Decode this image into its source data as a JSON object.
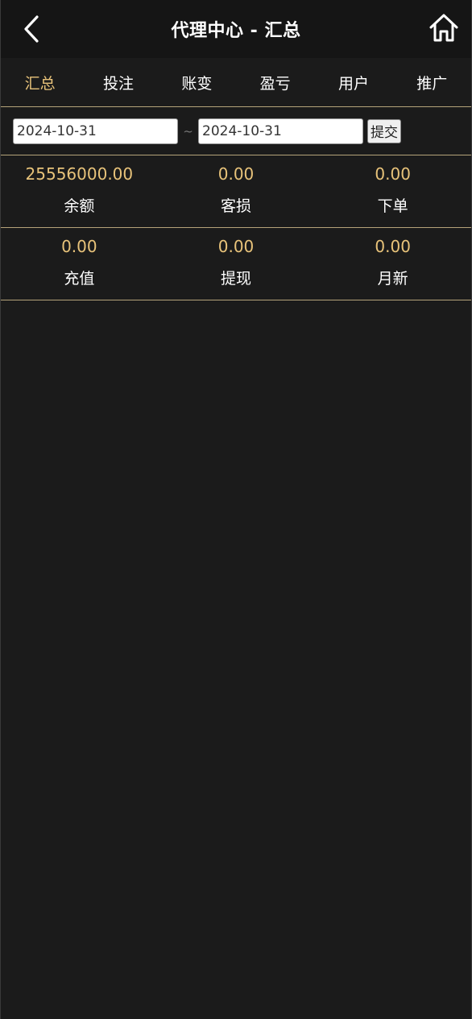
{
  "header": {
    "title": "代理中心 - 汇总",
    "back_icon": "chevron-left-icon",
    "home_icon": "home-icon"
  },
  "tabs": [
    {
      "label": "汇总",
      "active": true
    },
    {
      "label": "投注",
      "active": false
    },
    {
      "label": "账变",
      "active": false
    },
    {
      "label": "盈亏",
      "active": false
    },
    {
      "label": "用户",
      "active": false
    },
    {
      "label": "推广",
      "active": false
    }
  ],
  "filter": {
    "start_date": "2024-10-31",
    "separator": "~",
    "end_date": "2024-10-31",
    "submit_label": "提交"
  },
  "stats": {
    "row1": [
      {
        "value": "25556000.00",
        "label": "余额"
      },
      {
        "value": "0.00",
        "label": "客损"
      },
      {
        "value": "0.00",
        "label": "下单"
      }
    ],
    "row2": [
      {
        "value": "0.00",
        "label": "充值"
      },
      {
        "value": "0.00",
        "label": "提现"
      },
      {
        "value": "0.00",
        "label": "月新"
      }
    ]
  },
  "colors": {
    "accent": "#e8c37a",
    "background": "#1b1b1b",
    "header_bg": "#151515",
    "divider": "#b5a37a"
  }
}
